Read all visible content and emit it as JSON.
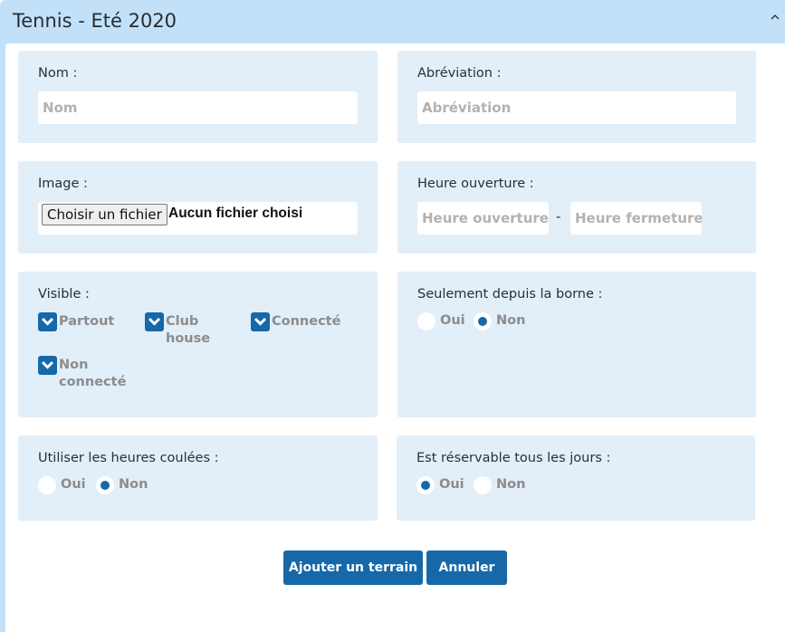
{
  "panel": {
    "title": "Tennis - Eté 2020"
  },
  "form": {
    "nom": {
      "label": "Nom :",
      "placeholder": "Nom"
    },
    "abreviation": {
      "label": "Abréviation :",
      "placeholder": "Abréviation"
    },
    "image": {
      "label": "Image :",
      "button_label": "Choisir un fichier",
      "status": "Aucun fichier choisi"
    },
    "heures": {
      "label": "Heure ouverture :",
      "open_placeholder": "Heure ouverture",
      "separator": "-",
      "close_placeholder": "Heure fermeture"
    },
    "visible": {
      "label": "Visible :",
      "options": [
        {
          "label": "Partout",
          "checked": true
        },
        {
          "label": "Club house",
          "checked": true
        },
        {
          "label": "Connecté",
          "checked": true
        },
        {
          "label": "Non connecté",
          "checked": true
        }
      ]
    },
    "borne": {
      "label": "Seulement depuis la borne :",
      "options": [
        "Oui",
        "Non"
      ],
      "selected": "Non"
    },
    "heures_coulees": {
      "label": "Utiliser les heures coulées :",
      "options": [
        "Oui",
        "Non"
      ],
      "selected": "Non"
    },
    "reservable": {
      "label": "Est réservable tous les jours :",
      "options": [
        "Oui",
        "Non"
      ],
      "selected": "Oui"
    }
  },
  "actions": {
    "submit_label": "Ajouter un terrain",
    "cancel_label": "Annuler"
  },
  "icons": {
    "collapse": "chevron-up-icon",
    "checkbox": "check-icon"
  },
  "colors": {
    "header_bg": "#c2e1f9",
    "card_bg": "#e2eef8",
    "accent": "#1668a8"
  }
}
